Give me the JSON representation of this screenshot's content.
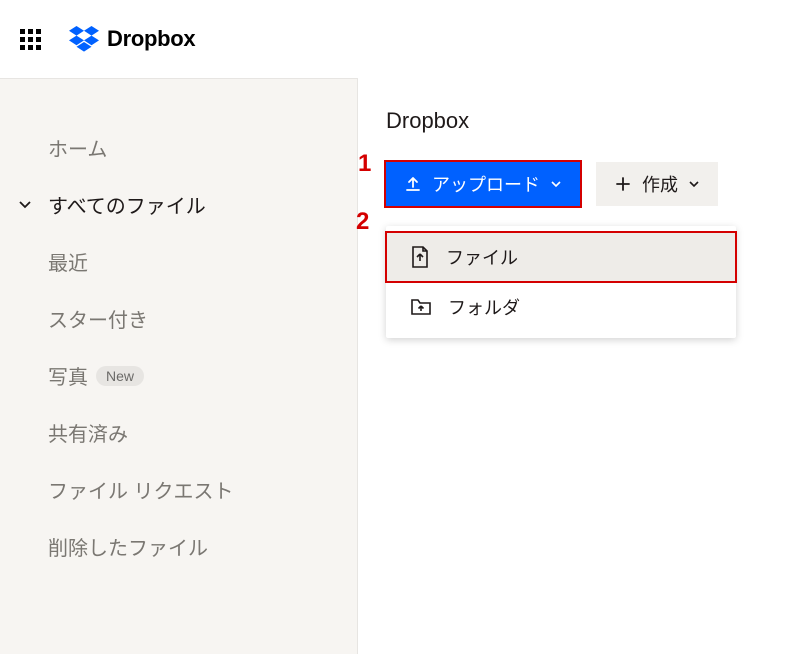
{
  "header": {
    "brand": "Dropbox"
  },
  "sidebar": {
    "items": [
      {
        "label": "ホーム"
      },
      {
        "label": "すべてのファイル",
        "active": true
      },
      {
        "label": "最近"
      },
      {
        "label": "スター付き"
      },
      {
        "label": "写真",
        "badge": "New"
      },
      {
        "label": "共有済み"
      },
      {
        "label": "ファイル リクエスト"
      },
      {
        "label": "削除したファイル"
      }
    ]
  },
  "main": {
    "breadcrumb": "Dropbox",
    "upload_label": "アップロード",
    "create_label": "作成",
    "menu": {
      "file": "ファイル",
      "folder": "フォルダ"
    }
  },
  "annotations": {
    "one": "1",
    "two": "2"
  }
}
